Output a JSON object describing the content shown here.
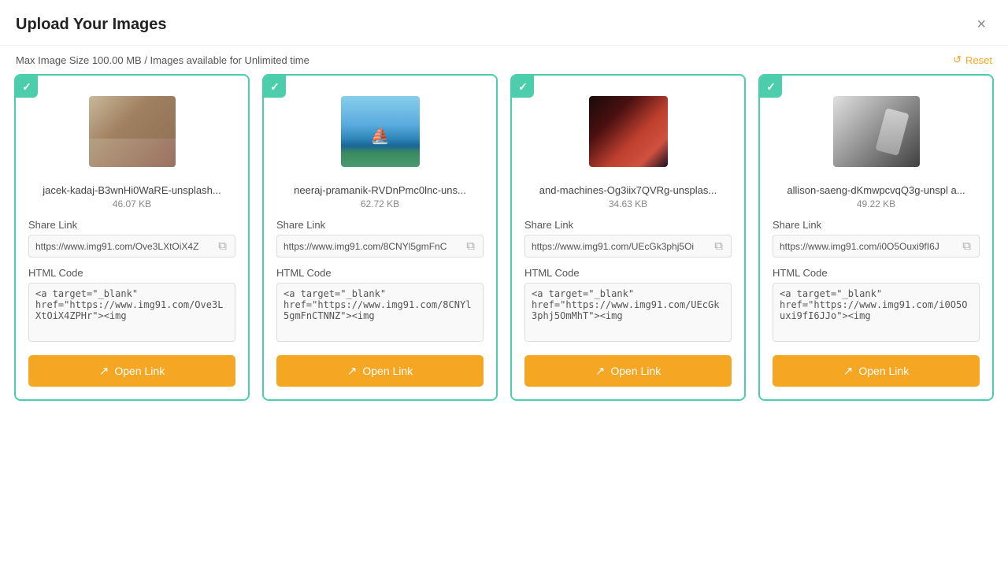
{
  "header": {
    "title": "Upload Your Images",
    "close_label": "×"
  },
  "subheader": {
    "text": "Max Image Size ",
    "max_size": "100.00 MB",
    "separator": " / Images available for ",
    "availability": "Unlimited time",
    "reset_label": "Reset"
  },
  "cards": [
    {
      "id": 1,
      "filename": "jacek-kadaj-B3wnHi0WaRE-unsplash...",
      "filesize": "46.07 KB",
      "share_link_label": "Share Link",
      "share_link": "https://www.img91.com/Ove3LXtOiX4Z",
      "html_code_label": "HTML Code",
      "html_code": "<a target=\"_blank\" href=\"https://www.img91.com/Ove3LXtOiX4ZPHr\"><img",
      "open_link_label": "Open Link"
    },
    {
      "id": 2,
      "filename": "neeraj-pramanik-RVDnPmc0lnc-uns...",
      "filesize": "62.72 KB",
      "share_link_label": "Share Link",
      "share_link": "https://www.img91.com/8CNYl5gmFnC",
      "html_code_label": "HTML Code",
      "html_code": "<a target=\"_blank\" href=\"https://www.img91.com/8CNYl5gmFnCTNNZ\"><img",
      "open_link_label": "Open Link"
    },
    {
      "id": 3,
      "filename": "and-machines-Og3iix7QVRg-unsplas...",
      "filesize": "34.63 KB",
      "share_link_label": "Share Link",
      "share_link": "https://www.img91.com/UEcGk3phj5Oi",
      "html_code_label": "HTML Code",
      "html_code": "<a target=\"_blank\" href=\"https://www.img91.com/UEcGk3phj5OmMhT\"><img",
      "open_link_label": "Open Link"
    },
    {
      "id": 4,
      "filename": "allison-saeng-dKmwpcvqQ3g-unspl a...",
      "filesize": "49.22 KB",
      "share_link_label": "Share Link",
      "share_link": "https://www.img91.com/i0O5Ouxi9fI6J",
      "html_code_label": "HTML Code",
      "html_code": "<a target=\"_blank\" href=\"https://www.img91.com/i0O5Ouxi9fI6JJo\"><img",
      "open_link_label": "Open Link"
    }
  ]
}
